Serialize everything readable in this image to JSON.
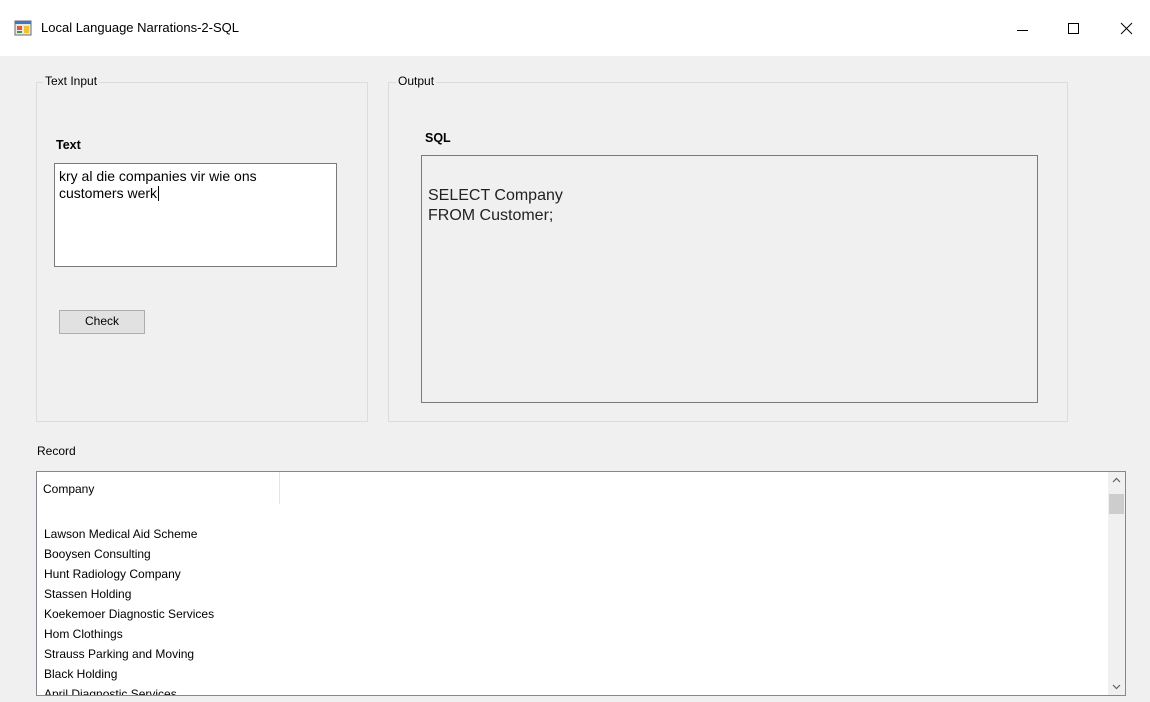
{
  "window": {
    "title": "Local Language Narrations-2-SQL"
  },
  "text_input": {
    "group_label": "Text Input",
    "text_label": "Text",
    "text_value": "kry al die companies vir wie ons\ncustomers werk",
    "check_label": "Check"
  },
  "output": {
    "group_label": "Output",
    "sql_label": "SQL",
    "sql_value": "SELECT Company\nFROM Customer;"
  },
  "record": {
    "label": "Record",
    "columns": [
      "Company"
    ],
    "rows": [
      "Lawson Medical Aid Scheme",
      "Booysen Consulting",
      "Hunt Radiology Company",
      "Stassen Holding",
      "Koekemoer Diagnostic Services",
      "Hom Clothings",
      "Strauss Parking and Moving",
      "Black Holding",
      "April Diagnostic Services"
    ]
  },
  "icons": {
    "app": "app-form-icon",
    "minimize": "minimize-icon",
    "maximize": "maximize-icon",
    "close": "close-icon",
    "scroll_up": "chevron-up-icon",
    "scroll_down": "chevron-down-icon"
  },
  "colors": {
    "background": "#f0f0f0",
    "titlebar": "#ffffff",
    "border": "#7a7a7a",
    "button": "#e1e1e1"
  }
}
